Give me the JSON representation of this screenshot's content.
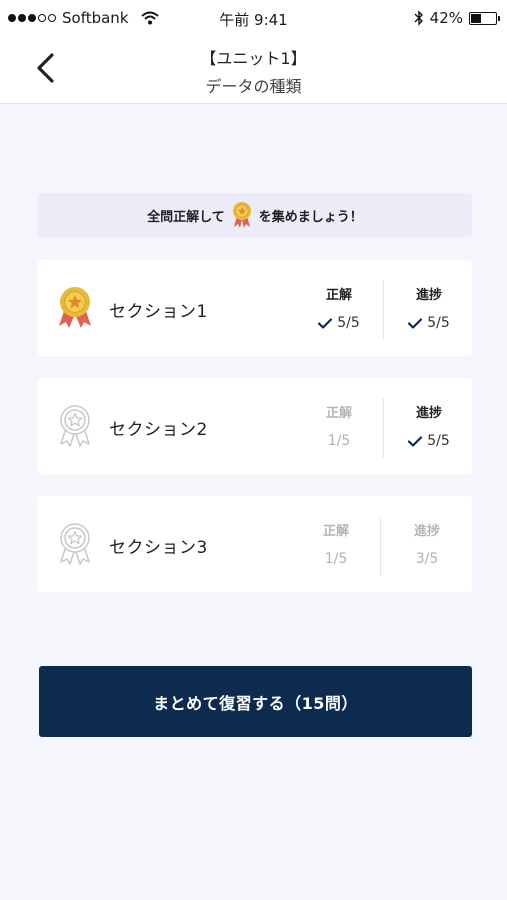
{
  "status_bar": {
    "carrier": "Softbank",
    "time": "午前 9:41",
    "battery": "42%",
    "battery_level": 0.42
  },
  "header": {
    "title": "【ユニット1】",
    "subtitle": "データの種類"
  },
  "banner": {
    "text_before": "全問正解して",
    "text_after": "を集めましょう！"
  },
  "sections": [
    {
      "name": "セクション1",
      "medal": "gold",
      "correct_label": "正解",
      "correct_value": "5/5",
      "correct_done": true,
      "progress_label": "進捗",
      "progress_value": "5/5",
      "progress_done": true
    },
    {
      "name": "セクション2",
      "medal": "outline",
      "correct_label": "正解",
      "correct_value": "1/5",
      "correct_done": false,
      "progress_label": "進捗",
      "progress_value": "5/5",
      "progress_done": true
    },
    {
      "name": "セクション3",
      "medal": "outline",
      "correct_label": "正解",
      "correct_value": "1/5",
      "correct_done": false,
      "progress_label": "進捗",
      "progress_value": "3/5",
      "progress_done": false
    }
  ],
  "review_button": {
    "label": "まとめて復習する（15問）"
  },
  "colors": {
    "background": "#f5f6fb",
    "banner": "#ecebf8",
    "primary": "#0d2a4f",
    "gold": "#e8b93a",
    "ribbon": "#e0614f",
    "check": "#0d2a4f",
    "dim_text": "#b0b0b5"
  }
}
